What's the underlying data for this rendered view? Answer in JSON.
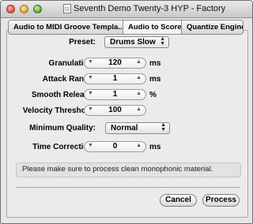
{
  "window": {
    "title": "Seventh Demo Twenty-3 HYP - Factory"
  },
  "tabs": [
    {
      "label": "Audio to MIDI Groove Templa..."
    },
    {
      "label": "Audio to Score"
    },
    {
      "label": "Quantize Engine"
    }
  ],
  "selected_tab": "Audio to Score",
  "form": {
    "preset": {
      "label": "Preset:",
      "value": "Drums Slow"
    },
    "granulation": {
      "label": "Granulation:",
      "value": "120",
      "unit": "ms"
    },
    "attack_range": {
      "label": "Attack Range:",
      "value": "1",
      "unit": "ms"
    },
    "smooth_release": {
      "label": "Smooth Release:",
      "value": "1",
      "unit": "%"
    },
    "velocity_threshold": {
      "label": "Velocity Threshold:",
      "value": "100"
    },
    "minimum_quality": {
      "label": "Minimum Quality:",
      "value": "Normal"
    },
    "time_correction": {
      "label": "Time Correction:",
      "value": "0",
      "unit": "ms"
    }
  },
  "message": "Please make sure to process clean monophonic material.",
  "buttons": {
    "cancel": "Cancel",
    "process": "Process"
  },
  "icons": {
    "popup_arrows": "up-down-arrows-icon",
    "stepper": "stepper-arrows-icon"
  }
}
